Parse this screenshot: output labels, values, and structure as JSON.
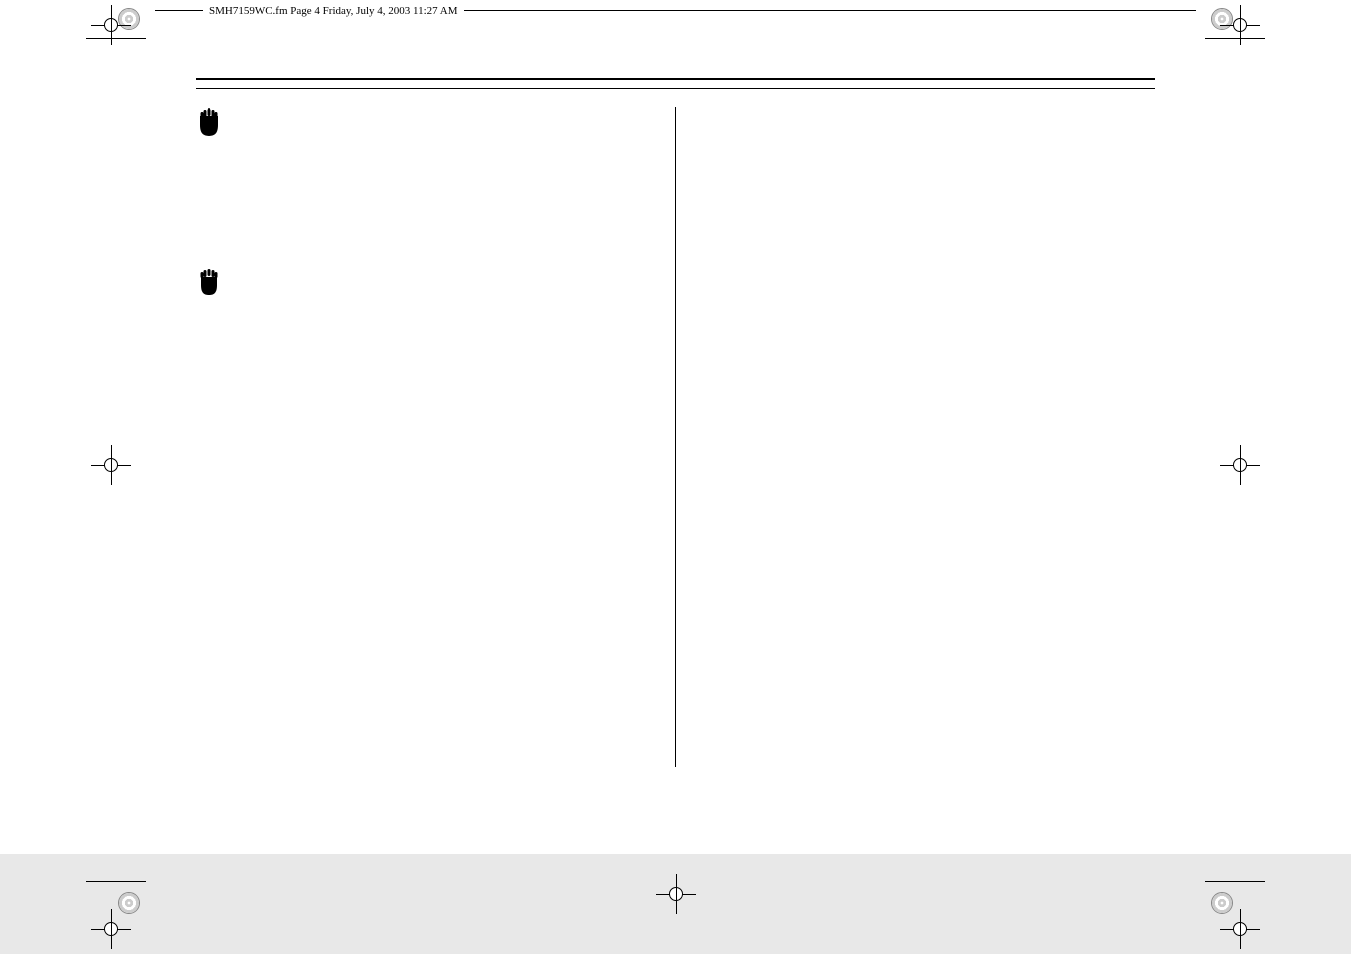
{
  "file_header": "SMH7159WC.fm  Page 4  Friday, July 4, 2003  11:27 AM",
  "warnings": [
    {
      "icon": "hand-icon",
      "text": ""
    },
    {
      "icon": "hand-icon",
      "text": ""
    }
  ]
}
